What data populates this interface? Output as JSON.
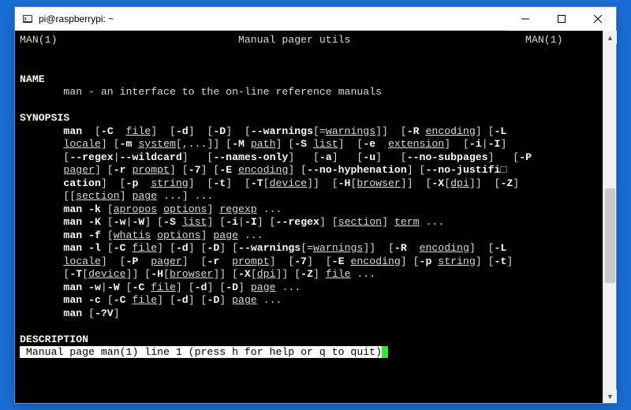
{
  "window": {
    "title": "pi@raspberrypi: ~"
  },
  "man": {
    "header_left": "MAN(1)",
    "header_center": "Manual pager utils",
    "header_right": "MAN(1)",
    "name_heading": "NAME",
    "name_line": "man - an interface to the on-line reference manuals",
    "synopsis_heading": "SYNOPSIS",
    "description_heading": "DESCRIPTION",
    "status_line": " Manual page man(1) line 1 (press h for help or q to quit)",
    "cmd": "man",
    "args": {
      "file": "file",
      "encoding": "encoding",
      "locale": "locale",
      "system": "system",
      "path": "path",
      "list": "list",
      "extension": "extension",
      "pager": "pager",
      "prompt": "prompt",
      "string": "string",
      "device": "device",
      "browser": "browser",
      "dpi": "dpi",
      "section": "section",
      "page": "page",
      "apropos": "apropos",
      "options": "options",
      "regexp": "regexp",
      "whatis": "whatis",
      "term": "term",
      "warnings": "warnings"
    },
    "flags": {
      "C": "-C",
      "d": "-d",
      "D": "-D",
      "warnings": "--warnings",
      "R": "-R",
      "L": "-L",
      "m": "-m",
      "M": "-M",
      "S": "-S",
      "e": "-e",
      "i": "-i",
      "I": "-I",
      "regex": "--regex",
      "wildcard": "--wildcard",
      "names_only": "--names-only",
      "a": "-a",
      "u": "-u",
      "no_subpages": "--no-subpages",
      "P": "-P",
      "r": "-r",
      "seven": "-7",
      "E": "-E",
      "no_hyph": "--no-hyphenation",
      "no_just": "--no-justifi",
      "cation": "cation",
      "p": "-p",
      "t": "-t",
      "T": "-T",
      "H": "-H",
      "X": "-X",
      "Z": "-Z",
      "k": "-k",
      "K": "-K",
      "w": "-w",
      "W": "-W",
      "f": "-f",
      "l": "-l",
      "c": "-c",
      "qv": "-?V"
    }
  }
}
